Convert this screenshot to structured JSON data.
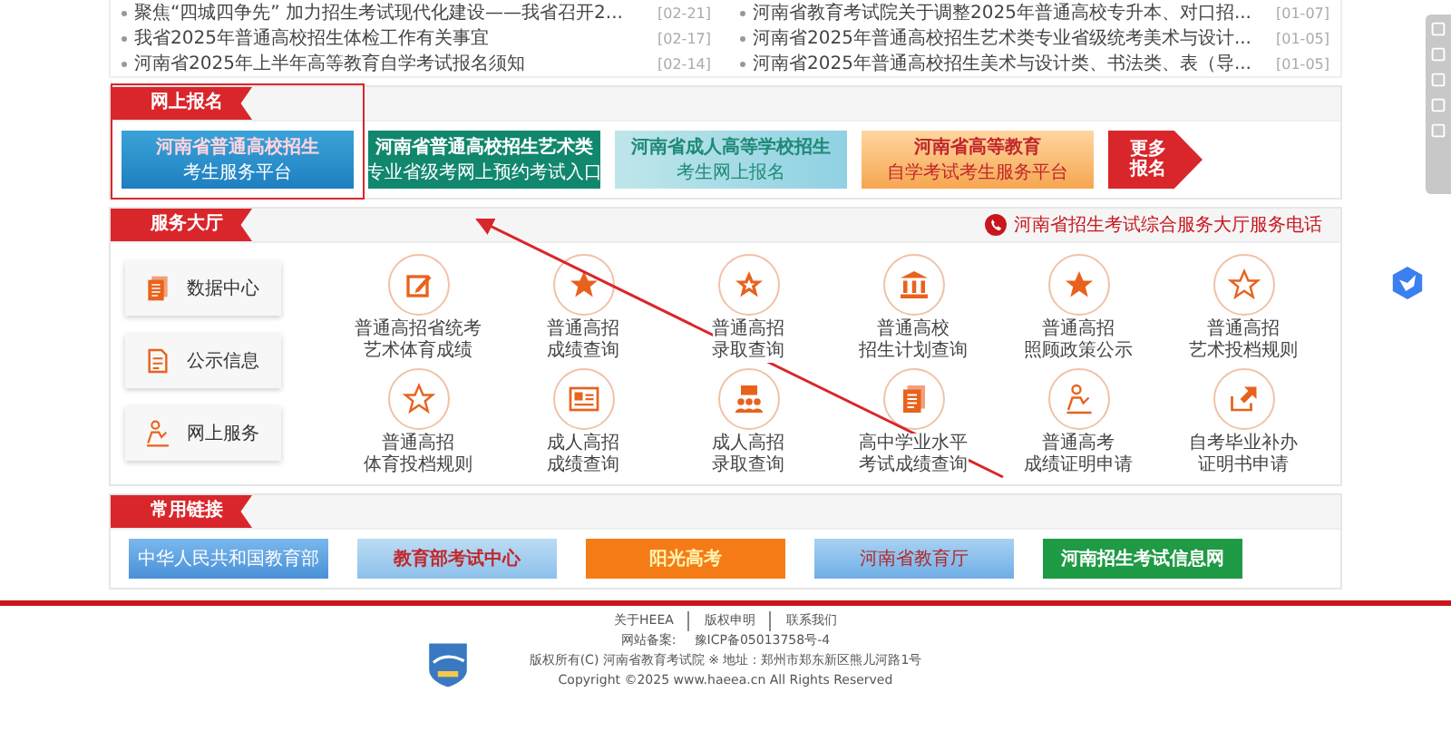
{
  "news": {
    "left": [
      {
        "title": "聚焦“四城四争先” 加力招生考试现代化建设——我省召开2...",
        "date": "[02-21]"
      },
      {
        "title": "我省2025年普通高校招生体检工作有关事宜",
        "date": "[02-17]"
      },
      {
        "title": "河南省2025年上半年高等教育自学考试报名须知",
        "date": "[02-14]"
      }
    ],
    "right": [
      {
        "title": "河南省教育考试院关于调整2025年普通高校专升本、对口招...",
        "date": "[01-07]"
      },
      {
        "title": "河南省2025年普通高校招生艺术类专业省级统考美术与设计...",
        "date": "[01-05]"
      },
      {
        "title": "河南省2025年普通高校招生美术与设计类、书法类、表（导...",
        "date": "[01-05]"
      }
    ]
  },
  "registration": {
    "title": "网上报名",
    "banners": [
      {
        "lines": [
          "河南省普通高校招生",
          "考生服务平台"
        ]
      },
      {
        "lines": [
          "河南省普通高校招生艺术类",
          "专业省级考网上预约考试入口"
        ]
      },
      {
        "lines": [
          "河南省成人高等学校招生",
          "考生网上报名"
        ]
      },
      {
        "lines": [
          "河南省高等教育",
          "自学考试考生服务平台"
        ]
      }
    ],
    "more": [
      "更多",
      "报名"
    ]
  },
  "service": {
    "title": "服务大厅",
    "hotline": "河南省招生考试综合服务大厅服务电话",
    "side": [
      {
        "label": "数据中心",
        "kind": "document"
      },
      {
        "label": "公示信息",
        "kind": "form"
      },
      {
        "label": "网上服务",
        "kind": "person"
      }
    ],
    "items": [
      {
        "lines": [
          "普通高招省统考",
          "艺术体育成绩"
        ],
        "kind": "edit"
      },
      {
        "lines": [
          "普通高招",
          "成绩查询"
        ],
        "kind": "star"
      },
      {
        "lines": [
          "普通高招",
          "录取查询"
        ],
        "kind": "star-badge"
      },
      {
        "lines": [
          "普通高校",
          "招生计划查询"
        ],
        "kind": "building"
      },
      {
        "lines": [
          "普通高招",
          "照顾政策公示"
        ],
        "kind": "star"
      },
      {
        "lines": [
          "普通高招",
          "艺术投档规则"
        ],
        "kind": "star-outline"
      },
      {
        "lines": [
          "普通高招",
          "体育投档规则"
        ],
        "kind": "star-outline"
      },
      {
        "lines": [
          "成人高招",
          "成绩查询"
        ],
        "kind": "card"
      },
      {
        "lines": [
          "成人高招",
          "录取查询"
        ],
        "kind": "group"
      },
      {
        "lines": [
          "高中学业水平",
          "考试成绩查询"
        ],
        "kind": "document"
      },
      {
        "lines": [
          "普通高考",
          "成绩证明申请"
        ],
        "kind": "person"
      },
      {
        "lines": [
          "自考毕业补办",
          "证明书申请"
        ],
        "kind": "export"
      }
    ]
  },
  "links": {
    "title": "常用链接",
    "banners": [
      "中华人民共和国教育部",
      "教育部考试中心",
      "阳光高考",
      "河南省教育厅",
      "河南招生考试信息网"
    ]
  },
  "footer": {
    "links": [
      "关于HEEA",
      "版权申明",
      "联系我们"
    ],
    "record_label": "网站备案:",
    "record": "豫ICP备05013758号-4",
    "copyright_cn": "版权所有(C) 河南省教育考试院 ※ 地址：郑州市郑东新区熊儿河路1号",
    "copyright": "Copyright ©2025 www.haeea.cn All Rights Reserved"
  }
}
